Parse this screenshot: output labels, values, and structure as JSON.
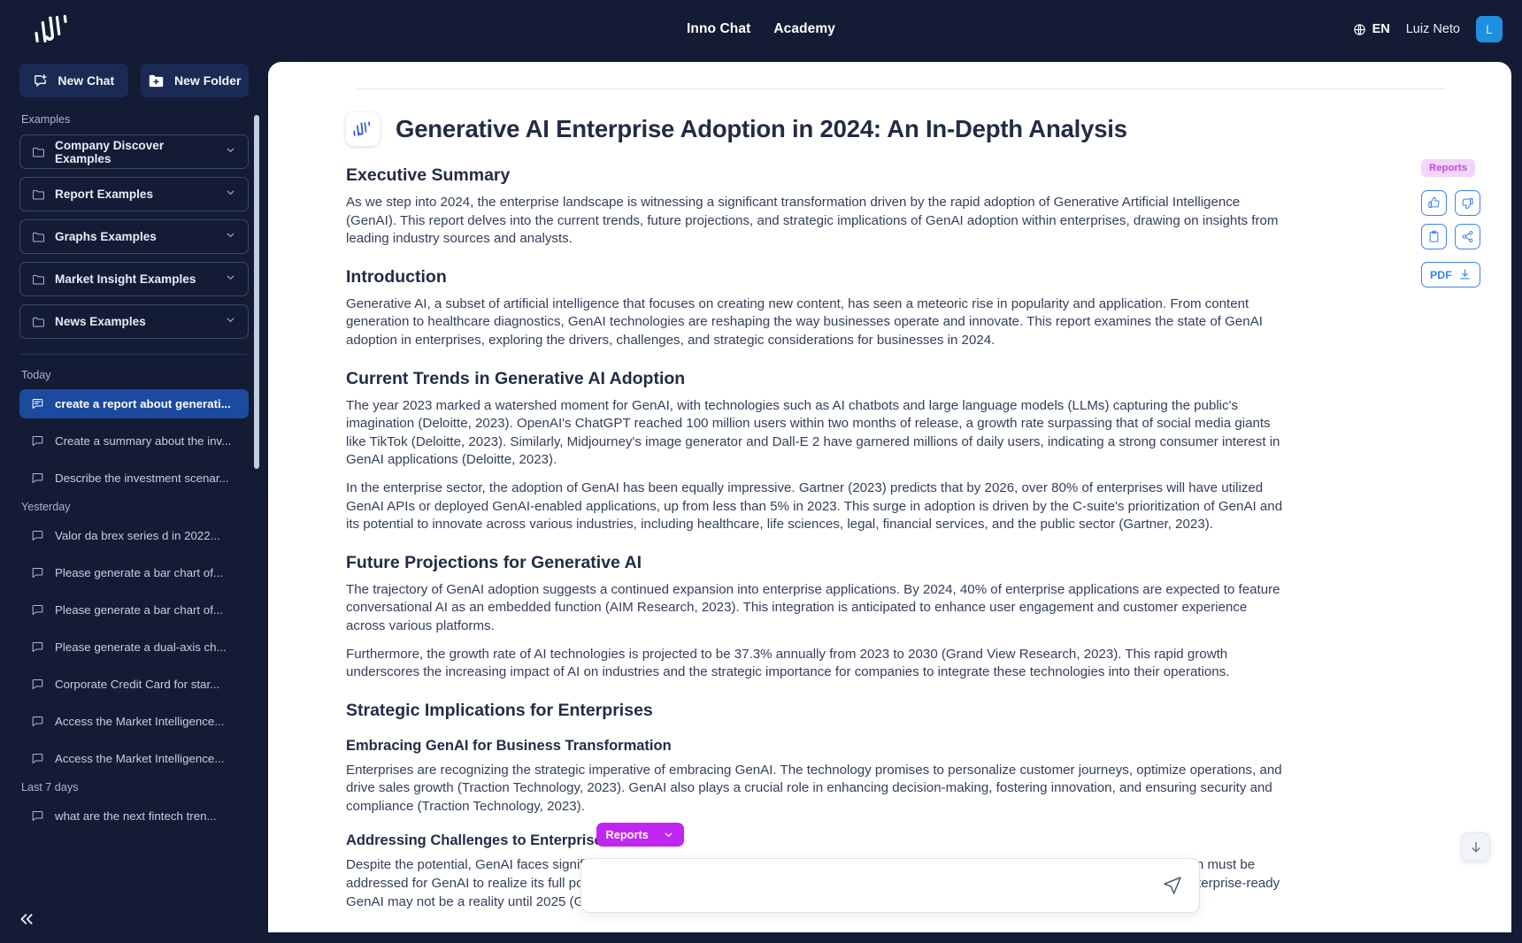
{
  "header": {
    "logo_icon": "inno-logo-icon",
    "nav": [
      {
        "label": "Inno Chat",
        "name": "nav-inno-chat"
      },
      {
        "label": "Academy",
        "name": "nav-academy"
      }
    ],
    "language": "EN",
    "language_icon": "globe-icon",
    "user_name": "Luiz Neto",
    "avatar_initial": "L"
  },
  "sidebar": {
    "new_chat_label": "New Chat",
    "new_chat_icon": "new-chat-icon",
    "new_folder_label": "New Folder",
    "new_folder_icon": "new-folder-icon",
    "examples_label": "Examples",
    "folders": [
      {
        "label": "Company Discover Examples"
      },
      {
        "label": "Report Examples"
      },
      {
        "label": "Graphs Examples"
      },
      {
        "label": "Market Insight Examples"
      },
      {
        "label": "News Examples"
      }
    ],
    "groups": [
      {
        "label": "Today",
        "items": [
          {
            "label": "create a report about generati...",
            "active": true
          },
          {
            "label": "Create a summary about the inv...",
            "active": false
          },
          {
            "label": "Describe the investment scenar...",
            "active": false
          }
        ]
      },
      {
        "label": "Yesterday",
        "items": [
          {
            "label": "Valor da brex series d in 2022...",
            "active": false
          },
          {
            "label": "Please generate a bar chart of...",
            "active": false
          },
          {
            "label": "Please generate a bar chart of...",
            "active": false
          },
          {
            "label": "Please generate a dual-axis ch...",
            "active": false
          },
          {
            "label": "Corporate Credit Card for star...",
            "active": false
          },
          {
            "label": "Access the Market Intelligence...",
            "active": false
          },
          {
            "label": "Access the Market Intelligence...",
            "active": false
          }
        ]
      },
      {
        "label": "Last 7 days",
        "items": [
          {
            "label": "what are the next fintech tren...",
            "active": false
          }
        ]
      }
    ],
    "collapse_icon": "collapse-sidebar-icon"
  },
  "document": {
    "title": "Generative AI Enterprise Adoption in 2024: An In-Depth Analysis",
    "doc_icon": "document-logo-icon",
    "blocks": [
      {
        "type": "h2",
        "text": "Executive Summary"
      },
      {
        "type": "p",
        "text": "As we step into 2024, the enterprise landscape is witnessing a significant transformation driven by the rapid adoption of Generative Artificial Intelligence (GenAI). This report delves into the current trends, future projections, and strategic implications of GenAI adoption within enterprises, drawing on insights from leading industry sources and analysts."
      },
      {
        "type": "h2",
        "text": "Introduction"
      },
      {
        "type": "p",
        "text": "Generative AI, a subset of artificial intelligence that focuses on creating new content, has seen a meteoric rise in popularity and application. From content generation to healthcare diagnostics, GenAI technologies are reshaping the way businesses operate and innovate. This report examines the state of GenAI adoption in enterprises, exploring the drivers, challenges, and strategic considerations for businesses in 2024."
      },
      {
        "type": "h2",
        "text": "Current Trends in Generative AI Adoption"
      },
      {
        "type": "p",
        "text": "The year 2023 marked a watershed moment for GenAI, with technologies such as AI chatbots and large language models (LLMs) capturing the public's imagination (Deloitte, 2023). OpenAI's ChatGPT reached 100 million users within two months of release, a growth rate surpassing that of social media giants like TikTok (Deloitte, 2023). Similarly, Midjourney's image generator and Dall-E 2 have garnered millions of daily users, indicating a strong consumer interest in GenAI applications (Deloitte, 2023)."
      },
      {
        "type": "p",
        "text": "In the enterprise sector, the adoption of GenAI has been equally impressive. Gartner (2023) predicts that by 2026, over 80% of enterprises will have utilized GenAI APIs or deployed GenAI-enabled applications, up from less than 5% in 2023. This surge in adoption is driven by the C-suite's prioritization of GenAI and its potential to innovate across various industries, including healthcare, life sciences, legal, financial services, and the public sector (Gartner, 2023)."
      },
      {
        "type": "h2",
        "text": "Future Projections for Generative AI"
      },
      {
        "type": "p",
        "text": "The trajectory of GenAI adoption suggests a continued expansion into enterprise applications. By 2024, 40% of enterprise applications are expected to feature conversational AI as an embedded function (AIM Research, 2023). This integration is anticipated to enhance user engagement and customer experience across various platforms."
      },
      {
        "type": "p",
        "text": "Furthermore, the growth rate of AI technologies is projected to be 37.3% annually from 2023 to 2030 (Grand View Research, 2023). This rapid growth underscores the increasing impact of AI on industries and the strategic importance for companies to integrate these technologies into their operations."
      },
      {
        "type": "h2",
        "text": "Strategic Implications for Enterprises"
      },
      {
        "type": "h3",
        "text": "Embracing GenAI for Business Transformation"
      },
      {
        "type": "p",
        "text": "Enterprises are recognizing the strategic imperative of embracing GenAI. The technology promises to personalize customer journeys, optimize operations, and drive sales growth (Traction Technology, 2023). GenAI also plays a crucial role in enhancing decision-making, fostering innovation, and ensuring security and compliance (Traction Technology, 2023)."
      },
      {
        "type": "h3",
        "text": "Addressing Challenges to Enterprise Readiness"
      },
      {
        "type": "p",
        "text": "Despite the potential, GenAI faces significant obstacles to enterprise readiness. Issues such as data privacy, ethics, scalability, and customization must be addressed for GenAI to realize its full potential in the corporate world (G2 Research, 2023). The complexity of these challenges suggests that enterprise-ready GenAI may not be a reality until 2025 (G2 Research, 2023)."
      }
    ]
  },
  "rail": {
    "tag_label": "Reports",
    "buttons": [
      {
        "name": "thumbs-up-button",
        "icon": "thumbs-up-icon"
      },
      {
        "name": "thumbs-down-button",
        "icon": "thumbs-down-icon"
      },
      {
        "name": "copy-button",
        "icon": "clipboard-icon"
      },
      {
        "name": "share-button",
        "icon": "share-icon"
      }
    ],
    "pdf_label": "PDF",
    "pdf_icon": "download-icon"
  },
  "composer": {
    "mode_label": "Reports",
    "mode_icon": "chevron-down-icon",
    "input_value": "",
    "placeholder": "",
    "send_icon": "send-icon"
  },
  "scroll_down_icon": "arrow-down-icon",
  "colors": {
    "app_bg": "#141b35",
    "sidebar_active": "#1c4a9e",
    "accent_blue": "#3b82f6",
    "accent_magenta": "#c026f0",
    "tag_bg": "#f3d6fb",
    "tag_fg": "#c24ae0",
    "avatar_bg": "#1f8fe0"
  }
}
